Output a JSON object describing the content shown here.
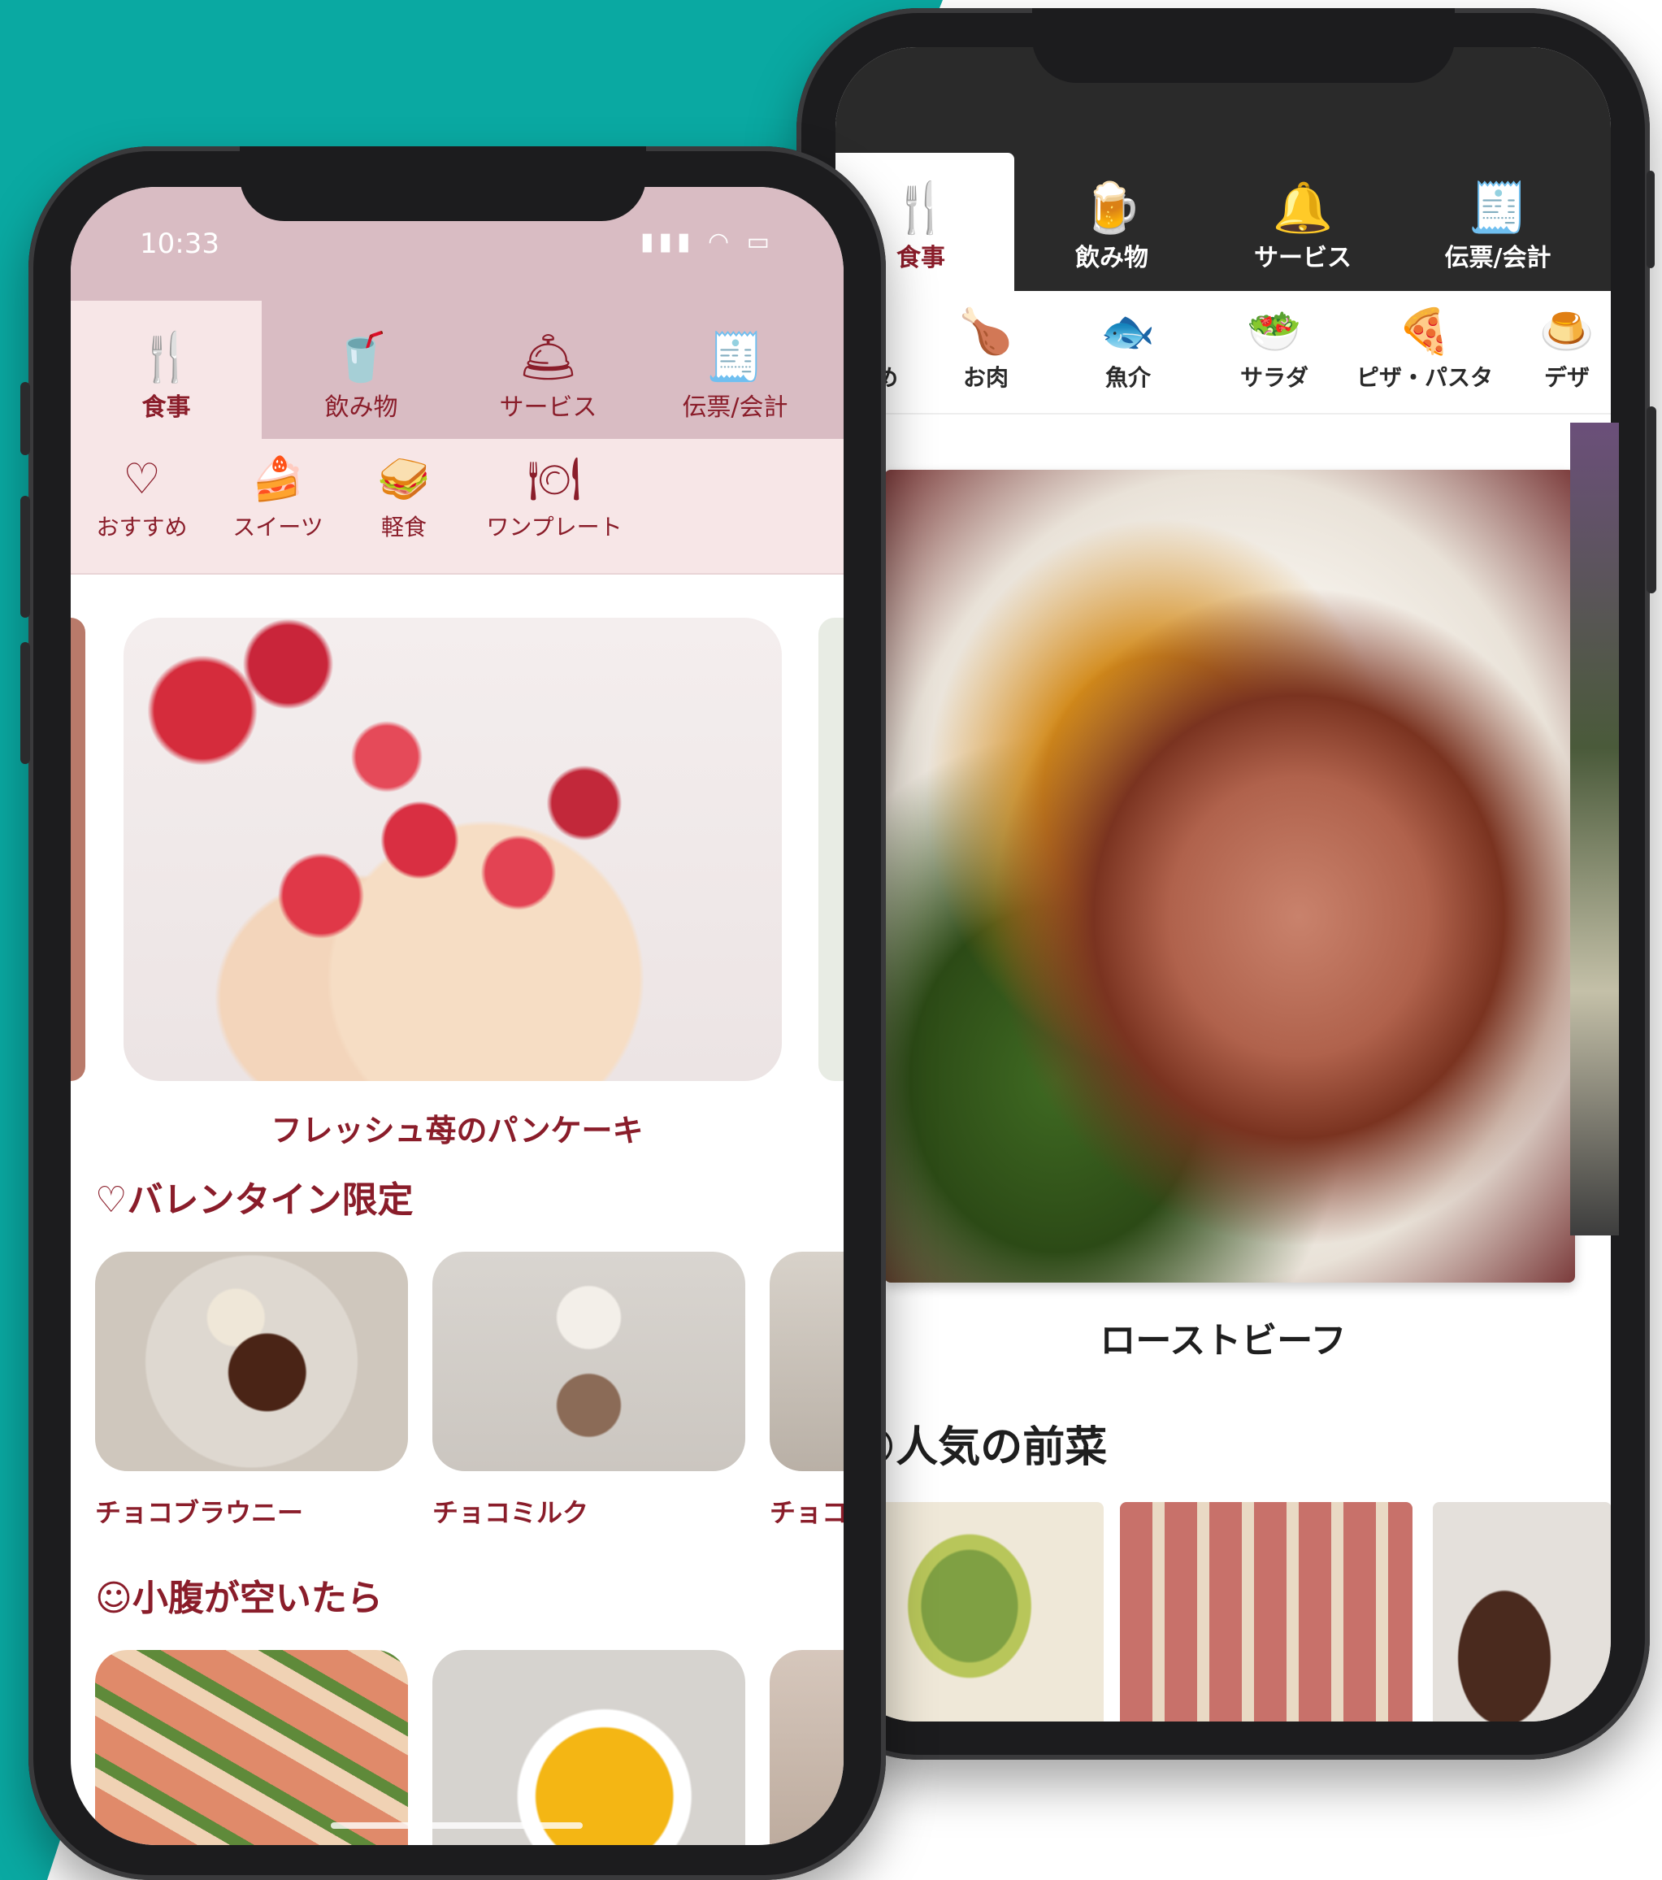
{
  "colors": {
    "teal": "#0aa9a2",
    "accent": "#8a1d2a",
    "pink_bar": "#d9bcc3",
    "pink_light": "#f7e6e7",
    "dark_bar": "#2a2a2a"
  },
  "back_phone": {
    "tabs": [
      {
        "label": "食事",
        "icon": "fork-knife-icon",
        "glyph": "🍴"
      },
      {
        "label": "飲み物",
        "icon": "beer-mug-icon",
        "glyph": "🍺"
      },
      {
        "label": "サービス",
        "icon": "bell-icon",
        "glyph": "🔔"
      },
      {
        "label": "伝票/会計",
        "icon": "receipt-icon",
        "glyph": "🧾"
      }
    ],
    "subcategories": [
      {
        "label": "すすめ",
        "icon": "heart-icon",
        "glyph": "♡"
      },
      {
        "label": "お肉",
        "icon": "roast-chicken-icon",
        "glyph": "🍗"
      },
      {
        "label": "魚介",
        "icon": "fish-icon",
        "glyph": "🐟"
      },
      {
        "label": "サラダ",
        "icon": "salad-icon",
        "glyph": "🥗"
      },
      {
        "label": "ピザ・パスタ",
        "icon": "pizza-icon",
        "glyph": "🍕"
      },
      {
        "label": "デザ",
        "icon": "dessert-icon",
        "glyph": "🍮"
      }
    ],
    "hero_title": "ローストビーフ",
    "section_title": "人気の前菜",
    "section_icon_glyph": "☺"
  },
  "front_phone": {
    "status_time": "10:33",
    "status_icons": "▮▮▮ ◠ ▭",
    "tabs": [
      {
        "label": "食事",
        "icon": "fork-knife-icon",
        "glyph": "🍴"
      },
      {
        "label": "飲み物",
        "icon": "drink-glass-icon",
        "glyph": "🥤"
      },
      {
        "label": "サービス",
        "icon": "service-bell-icon",
        "glyph": "🛎"
      },
      {
        "label": "伝票/会計",
        "icon": "receipt-icon",
        "glyph": "🧾"
      }
    ],
    "subcategories": [
      {
        "label": "おすすめ",
        "icon": "heart-icon",
        "glyph": "♡"
      },
      {
        "label": "スイーツ",
        "icon": "cake-icon",
        "glyph": "🍰"
      },
      {
        "label": "軽食",
        "icon": "sandwich-icon",
        "glyph": "🥪"
      },
      {
        "label": "ワンプレート",
        "icon": "plate-icon",
        "glyph": "🍽"
      }
    ],
    "hero_title": "フレッシュ苺のパンケーキ",
    "sections": [
      {
        "title": "♡バレンタイン限定",
        "items": [
          "チョコブラウニー",
          "チョコミルク",
          "チョコ"
        ]
      },
      {
        "title": "☺小腹が空いたら",
        "items": [
          "",
          "",
          ""
        ]
      }
    ]
  }
}
